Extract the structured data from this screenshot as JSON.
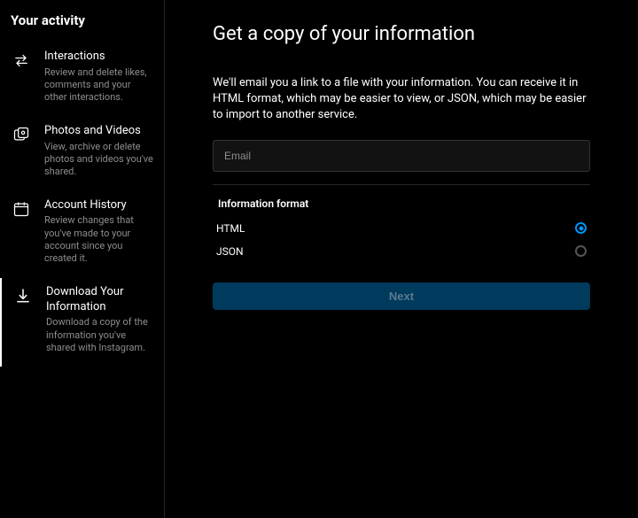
{
  "sidebar": {
    "title": "Your activity",
    "items": [
      {
        "label": "Interactions",
        "desc": "Review and delete likes, comments and your other interactions."
      },
      {
        "label": "Photos and Videos",
        "desc": "View, archive or delete photos and videos you've shared."
      },
      {
        "label": "Account History",
        "desc": "Review changes that you've made to your account since you created it."
      },
      {
        "label": "Download Your Information",
        "desc": "Download a copy of the information you've shared with Instagram."
      }
    ]
  },
  "main": {
    "title": "Get a copy of your information",
    "desc": "We'll email you a link to a file with your information. You can receive it in HTML format, which may be easier to view, or JSON, which may be easier to import to another service.",
    "email_placeholder": "Email",
    "format_label": "Information format",
    "options": {
      "html": "HTML",
      "json": "JSON"
    },
    "next_label": "Next"
  }
}
